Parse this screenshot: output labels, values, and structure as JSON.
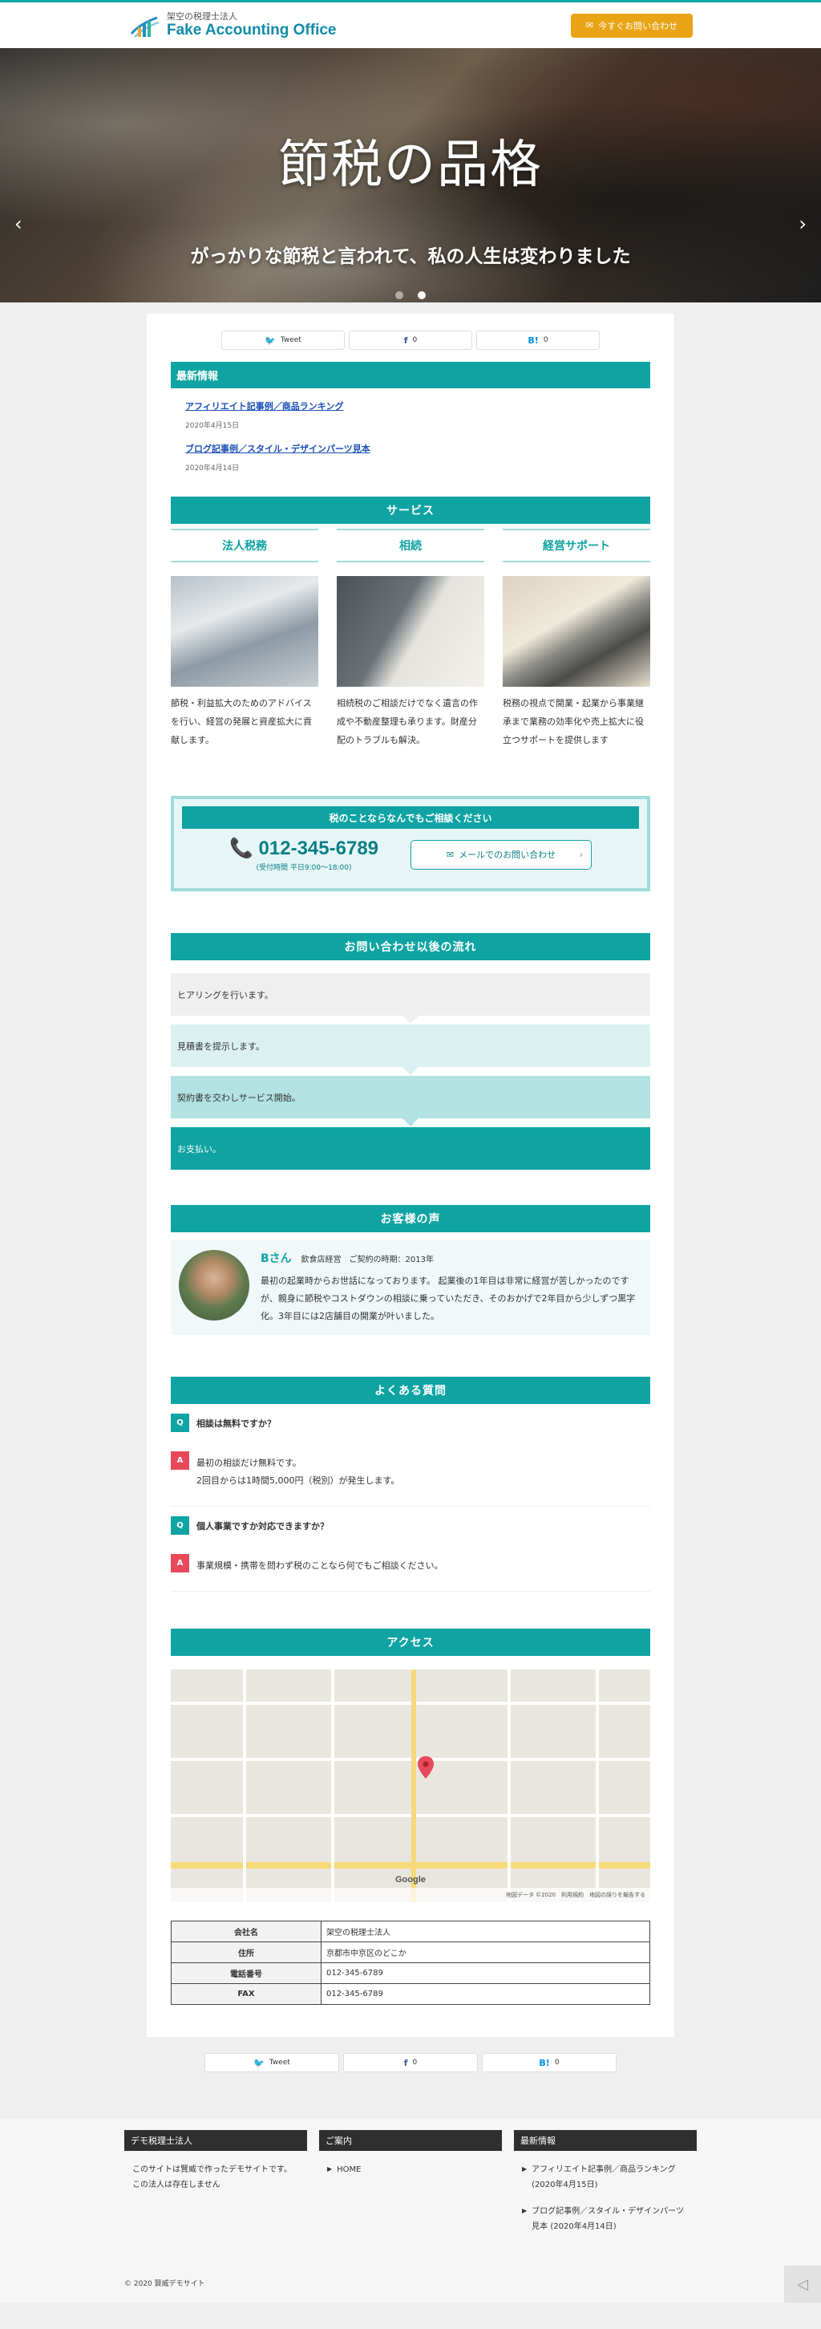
{
  "header": {
    "logo_sub": "架空の税理士法人",
    "logo_main": "Fake Accounting Office",
    "cta_label": "今すぐお問い合わせ"
  },
  "hero": {
    "title": "節税の品格",
    "subtitle": "がっかりな節税と言われて、私の人生は変わりました",
    "slides": 2,
    "active_slide": 2
  },
  "share": {
    "tweet": "Tweet",
    "fb_count": "0",
    "hb_count": "0"
  },
  "news": {
    "heading": "最新情報",
    "items": [
      {
        "title": "アフィリエイト記事例／商品ランキング",
        "date": "2020年4月15日"
      },
      {
        "title": "ブログ記事例／スタイル・デザインパーツ見本",
        "date": "2020年4月14日"
      }
    ]
  },
  "services": {
    "heading": "サービス",
    "items": [
      {
        "title": "法人税務",
        "text": "節税・利益拡大のためのアドバイスを行い、経営の発展と資産拡大に貢献します。"
      },
      {
        "title": "相続",
        "text": "相続税のご相談だけでなく遺言の作成や不動産整理も承ります。財産分配のトラブルも解決。"
      },
      {
        "title": "経営サポート",
        "text": "税務の視点で開業・起業から事業継承まで業務の効率化や売上拡大に役立つサポートを提供します"
      }
    ]
  },
  "contact": {
    "heading": "税のことならなんでもご相談ください",
    "phone": "012-345-6789",
    "hours": "(受付時間 平日9:00～18:00)",
    "mail_label": "メールでのお問い合わせ"
  },
  "flow": {
    "heading": "お問い合わせ以後の流れ",
    "steps": [
      "ヒアリングを行います。",
      "見積書を提示します。",
      "契約書を交わしサービス開始。",
      "お支払い。"
    ]
  },
  "voice": {
    "heading": "お客様の声",
    "name": "Bさん",
    "meta": "飲食店経営　ご契約の時期：2013年",
    "text": "最初の起業時からお世話になっております。 起業後の1年目は非常に経営が苦しかったのですが、親身に節税やコストダウンの相談に乗っていただき、そのおかげで2年目から少しずつ黒字化。3年目には2店舗目の開業が叶いました。"
  },
  "faq": {
    "heading": "よくある質問",
    "q_badge": "Q",
    "a_badge": "A",
    "items": [
      {
        "q": "相談は無料ですか？",
        "a": "最初の相談だけ無料です。\n2回目からは1時間5,000円（税別）が発生します。"
      },
      {
        "q": "個人事業ですか対応できますか？",
        "a": "事業規模・携帯を問わず税のことなら何でもご相談ください。"
      }
    ]
  },
  "access": {
    "heading": "アクセス",
    "map_credit": "地図データ ©2020　利用規約　地図の誤りを報告する",
    "map_brand": "Google",
    "table": [
      {
        "key": "会社名",
        "value": "架空の税理士法人"
      },
      {
        "key": "住所",
        "value": "京都市中京区のどこか"
      },
      {
        "key": "電話番号",
        "value": "012-345-6789"
      },
      {
        "key": "FAX",
        "value": "012-345-6789"
      }
    ]
  },
  "footer": {
    "col1_head": "デモ税理士法人",
    "col1_text": "このサイトは賢威で作ったデモサイトです。 この法人は存在しません",
    "col2_head": "ご案内",
    "col2_items": [
      "HOME"
    ],
    "col3_head": "最新情報",
    "col3_items": [
      {
        "title": "アフィリエイト記事例／商品ランキング",
        "date": "(2020年4月15日)"
      },
      {
        "title": "ブログ記事例／スタイル・デザインパーツ見本",
        "date": "(2020年4月14日)"
      }
    ],
    "copyright": "© 2020 賢威デモサイト"
  },
  "colors": {
    "accent": "#0fa3a3",
    "cta": "#e9a415",
    "answer_badge": "#e8495a",
    "footer_head": "#2f2f2f"
  }
}
